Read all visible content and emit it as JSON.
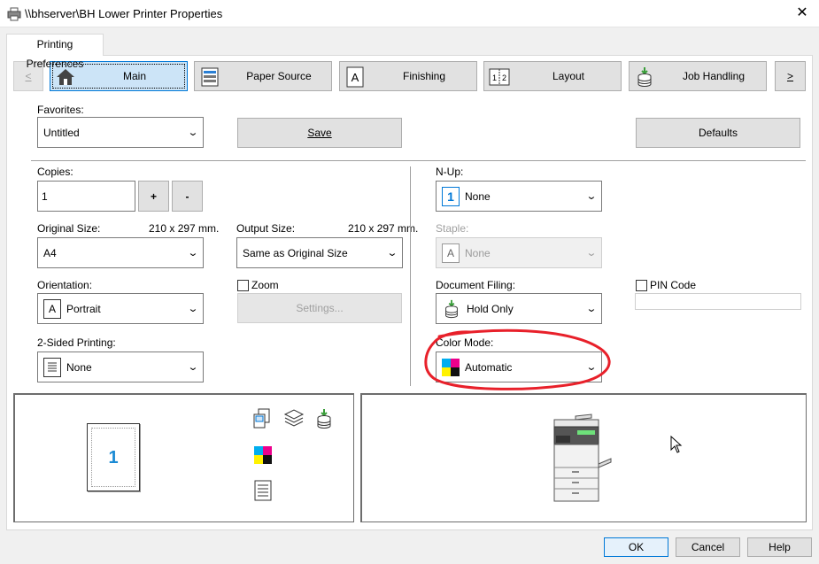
{
  "window": {
    "title": "\\\\bhserver\\BH Lower Printer Properties",
    "close_glyph": "✕"
  },
  "tab": {
    "label": "Printing Preferences"
  },
  "nav": {
    "prev": "<",
    "next": ">",
    "items": [
      {
        "label": "Main",
        "icon": "home-icon"
      },
      {
        "label": "Paper Source",
        "icon": "paper-source-icon"
      },
      {
        "label": "Finishing",
        "icon": "finishing-icon"
      },
      {
        "label": "Layout",
        "icon": "layout-icon"
      },
      {
        "label": "Job Handling",
        "icon": "job-handling-icon"
      }
    ]
  },
  "favorites": {
    "label": "Favorites:",
    "value": "Untitled",
    "save": "Save",
    "defaults": "Defaults"
  },
  "copies": {
    "label": "Copies:",
    "value": "1",
    "plus": "+",
    "minus": "-"
  },
  "original_size": {
    "label": "Original Size:",
    "dims": "210 x 297 mm.",
    "value": "A4"
  },
  "output_size": {
    "label": "Output Size:",
    "dims": "210 x 297 mm.",
    "value": "Same as Original Size"
  },
  "orientation": {
    "label": "Orientation:",
    "value": "Portrait",
    "icon_glyph": "A"
  },
  "zoom": {
    "label": "Zoom",
    "settings": "Settings..."
  },
  "two_sided": {
    "label": "2-Sided Printing:",
    "value": "None"
  },
  "nup": {
    "label": "N-Up:",
    "value": "None",
    "icon_glyph": "1"
  },
  "staple": {
    "label": "Staple:",
    "value": "None",
    "icon_glyph": "A"
  },
  "document_filing": {
    "label": "Document Filing:",
    "value": "Hold Only"
  },
  "pin": {
    "label": "PIN Code"
  },
  "color_mode": {
    "label": "Color Mode:",
    "value": "Automatic",
    "annotation_color": "#e8202a"
  },
  "preview": {
    "page_number": "1"
  },
  "footer": {
    "ok": "OK",
    "cancel": "Cancel",
    "help": "Help"
  },
  "colors": {
    "accent": "#0078d7",
    "preview_number": "#1a8ad4"
  }
}
